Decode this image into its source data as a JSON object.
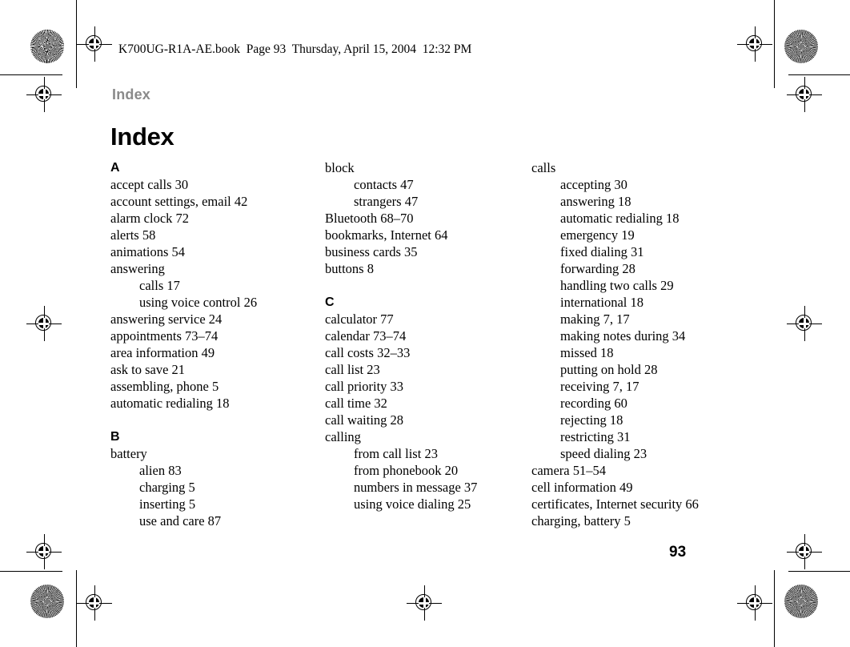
{
  "print_marks": {
    "book_line": "K700UG-R1A-AE.book  Page 93  Thursday, April 15, 2004  12:32 PM"
  },
  "running_header": "Index",
  "page_title": "Index",
  "page_number": "93",
  "colors": {
    "text": "#000000",
    "running_header": "#8a8a8a",
    "background": "#ffffff"
  },
  "index": {
    "columns": [
      {
        "blocks": [
          {
            "letter": "A",
            "entries": [
              {
                "text": "accept calls 30",
                "level": 0
              },
              {
                "text": "account settings, email 42",
                "level": 0
              },
              {
                "text": "alarm clock 72",
                "level": 0
              },
              {
                "text": "alerts 58",
                "level": 0
              },
              {
                "text": "animations 54",
                "level": 0
              },
              {
                "text": "answering",
                "level": 0
              },
              {
                "text": "calls 17",
                "level": 1
              },
              {
                "text": "using voice control 26",
                "level": 1
              },
              {
                "text": "answering service 24",
                "level": 0
              },
              {
                "text": "appointments 73–74",
                "level": 0
              },
              {
                "text": "area information 49",
                "level": 0
              },
              {
                "text": "ask to save 21",
                "level": 0
              },
              {
                "text": "assembling, phone 5",
                "level": 0
              },
              {
                "text": "automatic redialing 18",
                "level": 0
              }
            ]
          },
          {
            "letter": "B",
            "entries": [
              {
                "text": "battery",
                "level": 0
              },
              {
                "text": "alien 83",
                "level": 1
              },
              {
                "text": "charging 5",
                "level": 1
              },
              {
                "text": "inserting 5",
                "level": 1
              },
              {
                "text": "use and care 87",
                "level": 1
              }
            ]
          }
        ]
      },
      {
        "blocks": [
          {
            "letter": "",
            "entries": [
              {
                "text": "block",
                "level": 0
              },
              {
                "text": "contacts 47",
                "level": 1
              },
              {
                "text": "strangers 47",
                "level": 1
              },
              {
                "text": "Bluetooth 68–70",
                "level": 0
              },
              {
                "text": "bookmarks, Internet 64",
                "level": 0
              },
              {
                "text": "business cards 35",
                "level": 0
              },
              {
                "text": "buttons 8",
                "level": 0
              }
            ]
          },
          {
            "letter": "C",
            "entries": [
              {
                "text": "calculator 77",
                "level": 0
              },
              {
                "text": "calendar 73–74",
                "level": 0
              },
              {
                "text": "call costs 32–33",
                "level": 0
              },
              {
                "text": "call list 23",
                "level": 0
              },
              {
                "text": "call priority 33",
                "level": 0
              },
              {
                "text": "call time 32",
                "level": 0
              },
              {
                "text": "call waiting 28",
                "level": 0
              },
              {
                "text": "calling",
                "level": 0
              },
              {
                "text": "from call list 23",
                "level": 1
              },
              {
                "text": "from phonebook 20",
                "level": 1
              },
              {
                "text": "numbers in message 37",
                "level": 1
              },
              {
                "text": "using voice dialing 25",
                "level": 1
              }
            ]
          }
        ]
      },
      {
        "blocks": [
          {
            "letter": "",
            "entries": [
              {
                "text": "calls",
                "level": 0
              },
              {
                "text": "accepting 30",
                "level": 1
              },
              {
                "text": "answering 18",
                "level": 1
              },
              {
                "text": "automatic redialing 18",
                "level": 1
              },
              {
                "text": "emergency 19",
                "level": 1
              },
              {
                "text": "fixed dialing 31",
                "level": 1
              },
              {
                "text": "forwarding 28",
                "level": 1
              },
              {
                "text": "handling two calls 29",
                "level": 1
              },
              {
                "text": "international 18",
                "level": 1
              },
              {
                "text": "making 7, 17",
                "level": 1
              },
              {
                "text": "making notes during 34",
                "level": 1
              },
              {
                "text": "missed 18",
                "level": 1
              },
              {
                "text": "putting on hold 28",
                "level": 1
              },
              {
                "text": "receiving 7, 17",
                "level": 1
              },
              {
                "text": "recording 60",
                "level": 1
              },
              {
                "text": "rejecting 18",
                "level": 1
              },
              {
                "text": "restricting 31",
                "level": 1
              },
              {
                "text": "speed dialing 23",
                "level": 1
              },
              {
                "text": "camera 51–54",
                "level": 0
              },
              {
                "text": "cell information 49",
                "level": 0
              },
              {
                "text": "certificates, Internet security 66",
                "level": 0
              },
              {
                "text": "charging, battery 5",
                "level": 0
              }
            ]
          }
        ]
      }
    ]
  }
}
